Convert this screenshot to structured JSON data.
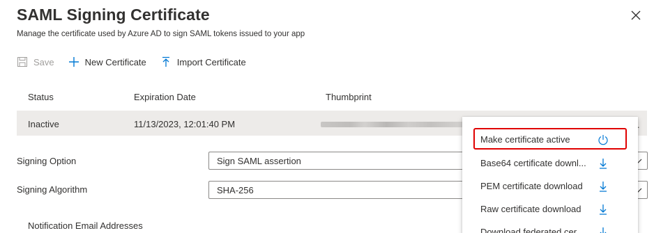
{
  "panel": {
    "title": "SAML Signing Certificate",
    "subtitle": "Manage the certificate used by Azure AD to sign SAML tokens issued to your app"
  },
  "toolbar": {
    "save_label": "Save",
    "new_label": "New Certificate",
    "import_label": "Import Certificate"
  },
  "table": {
    "columns": [
      "Status",
      "Expiration Date",
      "Thumbprint"
    ],
    "rows": [
      {
        "status": "Inactive",
        "expiration": "11/13/2023, 12:01:40 PM",
        "more": "..."
      }
    ]
  },
  "form": {
    "signing_option_label": "Signing Option",
    "signing_option_value": "Sign SAML assertion",
    "signing_algorithm_label": "Signing Algorithm",
    "signing_algorithm_value": "SHA-256",
    "notification_label": "Notification Email Addresses"
  },
  "context_menu": {
    "items": [
      {
        "label": "Make certificate active",
        "icon": "power-icon"
      },
      {
        "label": "Base64 certificate downl...",
        "icon": "download-icon"
      },
      {
        "label": "PEM certificate download",
        "icon": "download-icon"
      },
      {
        "label": "Raw certificate download",
        "icon": "download-icon"
      },
      {
        "label": "Download federated cer...",
        "icon": "download-icon"
      }
    ]
  },
  "colors": {
    "accent": "#0078d4",
    "highlight": "#e00000",
    "row_selected": "#edebe9"
  }
}
